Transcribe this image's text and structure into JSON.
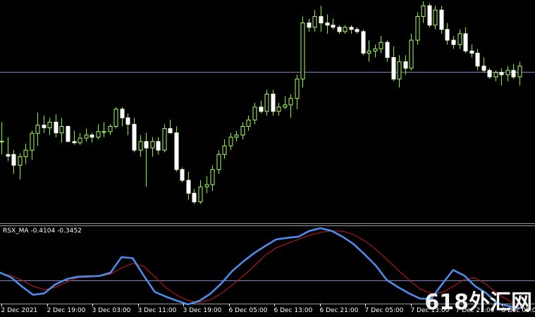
{
  "colors": {
    "background": "#000000",
    "bull_body": "#000000",
    "bull_outline": "#aaff66",
    "bear_body": "#ffffff",
    "wick": "#7cfc00",
    "level_line": "#7b86c8",
    "rsx_line": "#4f8be8",
    "ma_line": "#d01818",
    "axis_text": "#ffffff",
    "separator": "#9a9a9a"
  },
  "indicator": {
    "name": "RSX_MA",
    "value1": "-0.4104",
    "value2": "-0.3452"
  },
  "watermark": "618外汇网",
  "x_ticks": [
    "2 Dec 2021",
    "2 Dec 19:00",
    "3 Dec 03:00",
    "3 Dec 11:00",
    "3 Dec 19:00",
    "6 Dec 05:00",
    "6 Dec 13:00",
    "6 Dec 21:00",
    "7 Dec 05:00",
    "7 Dec 13:00",
    "7 Dec 21:00",
    "8 Dec 05:00"
  ],
  "chart_data": [
    {
      "type": "candlestick",
      "title": "",
      "xlabel": "",
      "ylabel": "",
      "ylim": [
        0,
        100
      ],
      "horizontal_level": 67.4,
      "candles": [
        [
          34.8,
          44.0,
          29.0,
          35.2
        ],
        [
          29.0,
          37.0,
          26.0,
          28.2
        ],
        [
          29.0,
          31.0,
          20.0,
          24.0
        ],
        [
          24.0,
          29.5,
          17.5,
          28.0
        ],
        [
          28.0,
          34.0,
          24.5,
          31.0
        ],
        [
          31.0,
          40.0,
          26.5,
          38.8
        ],
        [
          38.8,
          48.5,
          33.0,
          42.6
        ],
        [
          42.6,
          47.0,
          39.0,
          41.4
        ],
        [
          41.4,
          46.0,
          38.0,
          44.0
        ],
        [
          44.0,
          47.5,
          37.0,
          39.0
        ],
        [
          39.0,
          46.0,
          34.5,
          42.0
        ],
        [
          42.0,
          42.5,
          36.0,
          35.0
        ],
        [
          35.0,
          40.0,
          33.5,
          34.4
        ],
        [
          34.4,
          39.0,
          33.5,
          36.6
        ],
        [
          36.6,
          41.0,
          35.0,
          38.0
        ],
        [
          38.0,
          39.0,
          34.5,
          37.0
        ],
        [
          37.0,
          43.0,
          36.0,
          39.6
        ],
        [
          39.6,
          44.0,
          37.0,
          39.6
        ],
        [
          39.6,
          43.0,
          38.0,
          42.0
        ],
        [
          42.0,
          51.0,
          41.0,
          50.0
        ],
        [
          50.0,
          51.0,
          42.0,
          46.0
        ],
        [
          46.0,
          48.0,
          38.0,
          43.0
        ],
        [
          43.0,
          46.0,
          30.0,
          31.0
        ],
        [
          31.0,
          38.0,
          28.0,
          35.0
        ],
        [
          35.0,
          39.0,
          14.0,
          32.0
        ],
        [
          32.0,
          37.0,
          28.0,
          35.0
        ],
        [
          35.0,
          37.0,
          29.0,
          31.0
        ],
        [
          31.0,
          43.0,
          30.0,
          41.0
        ],
        [
          41.0,
          45.0,
          39.0,
          39.0
        ],
        [
          39.0,
          42.0,
          21.0,
          22.0
        ],
        [
          22.0,
          23.0,
          16.0,
          17.0
        ],
        [
          17.0,
          21.0,
          8.0,
          11.0
        ],
        [
          11.0,
          13.0,
          6.0,
          7.0
        ],
        [
          7.0,
          17.0,
          6.0,
          14.0
        ],
        [
          14.0,
          19.0,
          11.0,
          15.0
        ],
        [
          15.0,
          24.0,
          12.0,
          22.0
        ],
        [
          22.0,
          31.0,
          20.0,
          29.0
        ],
        [
          29.0,
          36.0,
          27.0,
          33.0
        ],
        [
          33.0,
          39.0,
          31.0,
          37.0
        ],
        [
          37.0,
          40.0,
          35.0,
          38.0
        ],
        [
          38.0,
          44.0,
          36.0,
          42.0
        ],
        [
          42.0,
          47.0,
          40.0,
          45.0
        ],
        [
          45.0,
          53.0,
          43.0,
          51.0
        ],
        [
          51.0,
          54.0,
          48.0,
          49.0
        ],
        [
          49.0,
          59.0,
          47.0,
          57.0
        ],
        [
          57.0,
          59.0,
          47.0,
          49.0
        ],
        [
          49.0,
          53.0,
          47.0,
          51.0
        ],
        [
          51.0,
          56.0,
          50.0,
          52.0
        ],
        [
          52.0,
          57.0,
          46.0,
          55.0
        ],
        [
          55.0,
          66.0,
          50.0,
          64.0
        ],
        [
          64.0,
          93.0,
          60.0,
          90.0
        ],
        [
          90.0,
          92.0,
          86.0,
          88.0
        ],
        [
          88.0,
          96.0,
          86.0,
          93.0
        ],
        [
          93.0,
          98.0,
          86.0,
          90.0
        ],
        [
          90.0,
          94.0,
          85.0,
          89.0
        ],
        [
          89.0,
          92.0,
          87.0,
          88.0
        ],
        [
          88.0,
          89.0,
          85.0,
          86.0
        ],
        [
          86.0,
          89.0,
          85.0,
          88.0
        ],
        [
          88.0,
          89.0,
          85.0,
          87.0
        ],
        [
          87.0,
          88.0,
          85.0,
          86.0
        ],
        [
          86.0,
          87.0,
          75.0,
          76.0
        ],
        [
          76.0,
          82.0,
          72.0,
          77.0
        ],
        [
          77.0,
          80.0,
          74.0,
          78.0
        ],
        [
          78.0,
          84.0,
          76.0,
          81.0
        ],
        [
          81.0,
          82.0,
          72.0,
          74.0
        ],
        [
          74.0,
          79.0,
          63.0,
          64.0
        ],
        [
          64.0,
          75.0,
          60.0,
          72.0
        ],
        [
          72.0,
          75.0,
          66.0,
          69.0
        ],
        [
          69.0,
          85.0,
          68.0,
          82.0
        ],
        [
          82.0,
          95.0,
          80.0,
          93.0
        ],
        [
          93.0,
          100.0,
          90.0,
          98.0
        ],
        [
          98.0,
          99.0,
          88.0,
          89.0
        ],
        [
          89.0,
          98.0,
          87.0,
          96.0
        ],
        [
          96.0,
          98.0,
          85.0,
          87.0
        ],
        [
          87.0,
          90.0,
          80.0,
          82.0
        ],
        [
          82.0,
          84.0,
          78.0,
          80.0
        ],
        [
          80.0,
          87.0,
          78.0,
          85.0
        ],
        [
          85.0,
          88.0,
          76.0,
          77.0
        ],
        [
          77.0,
          80.0,
          74.0,
          76.0
        ],
        [
          76.0,
          78.0,
          68.0,
          70.0
        ],
        [
          70.0,
          74.0,
          67.0,
          68.0
        ],
        [
          68.0,
          69.0,
          64.0,
          65.0
        ],
        [
          65.0,
          68.0,
          63.0,
          67.0
        ],
        [
          67.0,
          69.0,
          61.0,
          66.0
        ],
        [
          66.0,
          70.0,
          63.0,
          68.0
        ],
        [
          68.0,
          71.0,
          64.0,
          65.0
        ],
        [
          65.0,
          72.0,
          61.0,
          70.0
        ]
      ]
    },
    {
      "type": "line",
      "title": "RSX_MA -0.4104 -0.3452",
      "xlabel": "",
      "ylabel": "",
      "ylim": [
        -1,
        1
      ],
      "horizontal_level": -0.4,
      "series": [
        {
          "name": "",
          "color": "#4f8be8",
          "values": [
            -0.2,
            -0.33,
            -0.58,
            -0.8,
            -0.76,
            -0.52,
            -0.38,
            -0.31,
            -0.3,
            -0.29,
            -0.2,
            0.22,
            0.19,
            -0.28,
            -0.72,
            -0.85,
            -0.96,
            -1.06,
            -0.97,
            -0.78,
            -0.5,
            -0.16,
            0.1,
            0.33,
            0.52,
            0.7,
            0.74,
            0.77,
            0.93,
            1.0,
            0.93,
            0.77,
            0.57,
            0.29,
            -0.01,
            -0.4,
            -0.59,
            -0.76,
            -0.9,
            -0.91,
            -0.51,
            -0.13,
            -0.28,
            -0.57,
            -0.76,
            -1.03,
            -1.1,
            -1.16
          ]
        },
        {
          "name": "",
          "color": "#d01818",
          "values": [
            -0.21,
            -0.28,
            -0.41,
            -0.57,
            -0.66,
            -0.6,
            -0.46,
            -0.34,
            -0.32,
            -0.3,
            -0.24,
            -0.07,
            0.05,
            -0.03,
            -0.31,
            -0.6,
            -0.81,
            -0.95,
            -1.01,
            -0.94,
            -0.77,
            -0.54,
            -0.29,
            -0.02,
            0.27,
            0.47,
            0.59,
            0.7,
            0.81,
            0.89,
            0.93,
            0.92,
            0.83,
            0.66,
            0.43,
            0.16,
            -0.13,
            -0.4,
            -0.64,
            -0.76,
            -0.74,
            -0.57,
            -0.39,
            -0.34,
            -0.52,
            -0.77,
            -0.95,
            -1.09
          ]
        }
      ]
    }
  ]
}
